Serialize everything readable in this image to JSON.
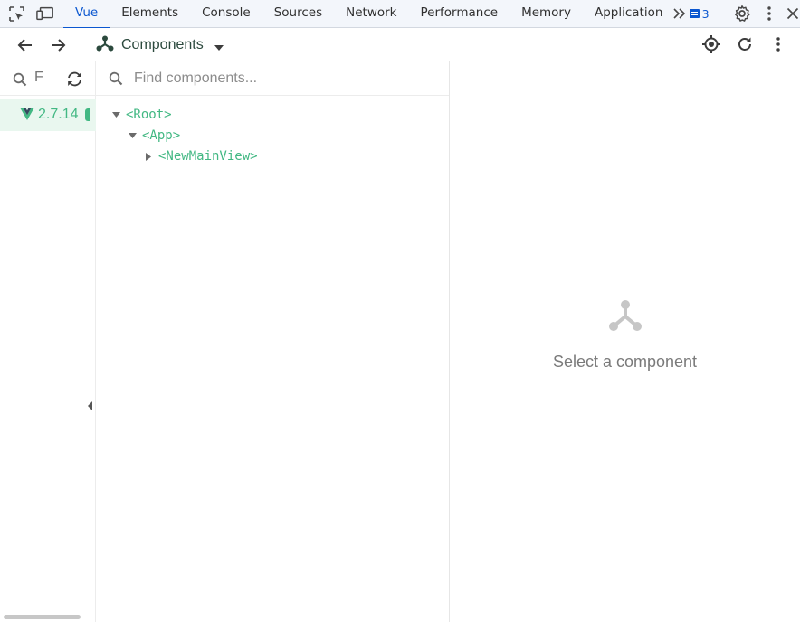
{
  "devtools": {
    "tabs": [
      "Vue",
      "Elements",
      "Console",
      "Sources",
      "Network",
      "Performance",
      "Memory",
      "Application"
    ],
    "active_tab": "Vue",
    "more_tabs_icon": "double-chevron-right-icon",
    "issues_count": "3"
  },
  "vue_toolbar": {
    "view_label": "Components"
  },
  "sidebar": {
    "filter_placeholder": "F",
    "app_version": "2.7.14"
  },
  "tree": {
    "search_placeholder": "Find components...",
    "nodes": [
      {
        "label": "<Root>",
        "expanded": true,
        "depth": 0
      },
      {
        "label": "<App>",
        "expanded": true,
        "depth": 1
      },
      {
        "label": "<NewMainView>",
        "expanded": false,
        "depth": 2
      }
    ]
  },
  "details": {
    "empty_text": "Select a component",
    "empty_icon": "component-tree-icon"
  },
  "colors": {
    "vue_green": "#42b883",
    "accent_blue": "#0b57d0",
    "active_row": "#e9f7ef"
  }
}
